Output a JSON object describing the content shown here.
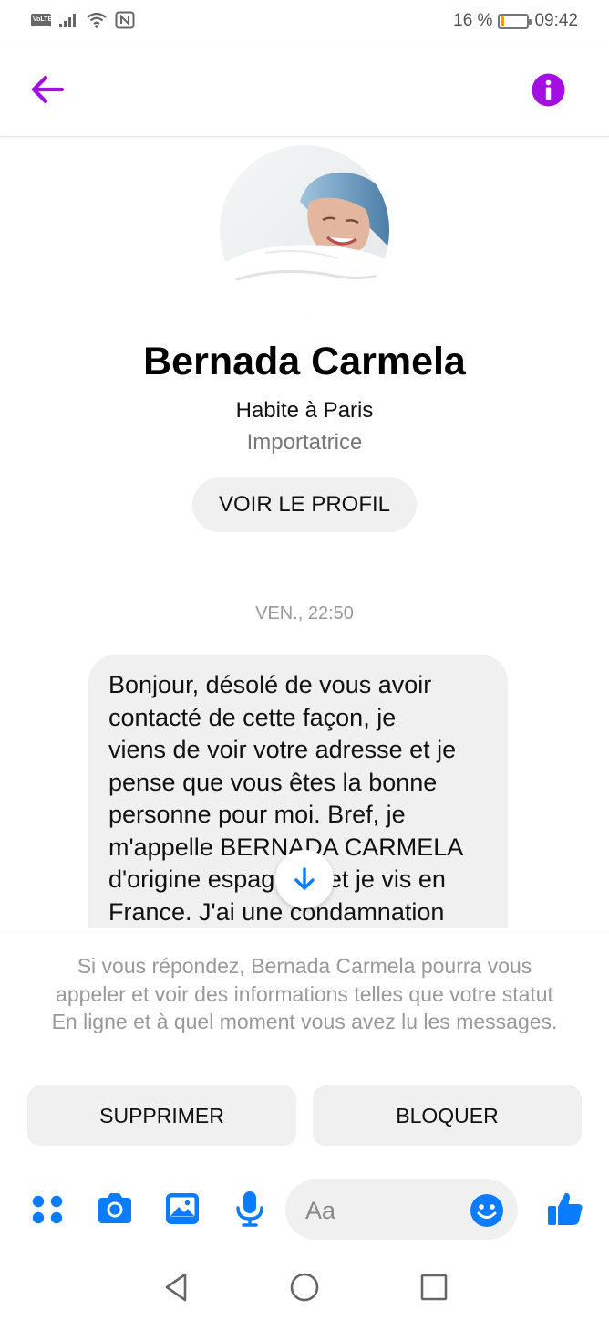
{
  "status_bar": {
    "volte": "VoLTE",
    "battery_percent": "16 %",
    "battery_level": 0.16,
    "time": "09:42"
  },
  "header": {
    "back_icon": "arrow-left-icon",
    "info_icon": "info-icon",
    "accent_color": "#a20fe0"
  },
  "profile": {
    "name": "Bernada Carmela",
    "location": "Habite à Paris",
    "occupation": "Importatrice",
    "view_profile_label": "VOIR LE PROFIL"
  },
  "conversation": {
    "timestamp": "VEN., 22:50",
    "message_lines": [
      "Bonjour, désolé de vous avoir",
      "contacté de cette façon, je",
      "viens de voir votre adresse et je",
      "pense que vous êtes la bonne",
      "personne pour moi.  Bref, je",
      "m'appelle BERNADA CARMELA",
      "d'origine espagnole et je vis en",
      "France.  J'ai une condamnation"
    ]
  },
  "request": {
    "notice": "Si vous répondez, Bernada Carmela pourra vous appeler et voir des informations telles que votre statut En ligne et à quel moment vous avez lu les messages.",
    "delete_label": "SUPPRIMER",
    "block_label": "BLOQUER"
  },
  "composer": {
    "placeholder": "Aa",
    "icons": [
      "apps-icon",
      "camera-icon",
      "gallery-icon",
      "microphone-icon",
      "emoji-icon",
      "thumbs-up-icon"
    ],
    "accent_color": "#0a7cff"
  },
  "nav": {
    "icons": [
      "back-triangle-icon",
      "home-circle-icon",
      "recents-square-icon"
    ]
  }
}
